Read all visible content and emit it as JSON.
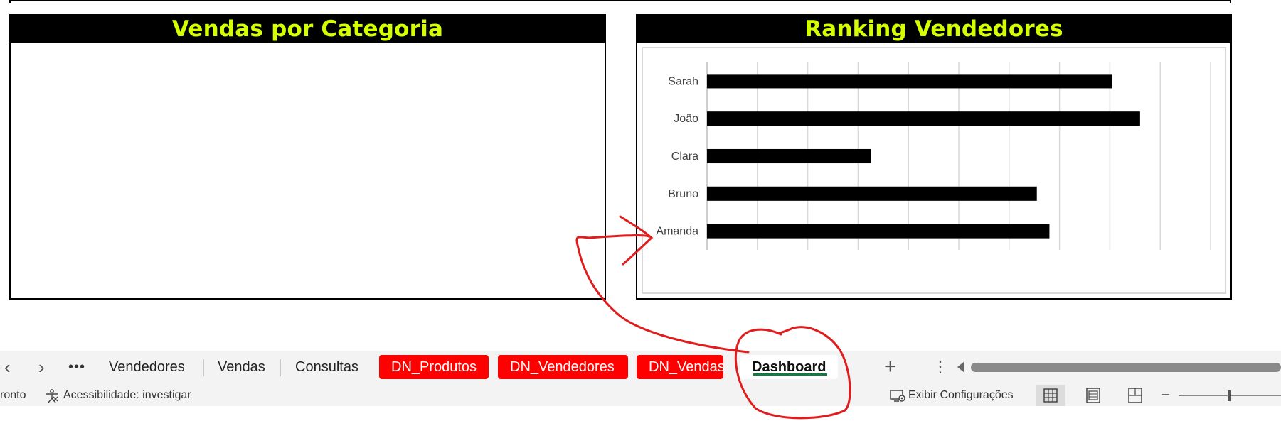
{
  "panels": {
    "left_title": "Vendas por Categoria",
    "right_title": "Ranking Vendedores"
  },
  "chart_data": {
    "type": "bar",
    "orientation": "horizontal",
    "title": "",
    "categories": [
      "Sarah",
      "João",
      "Clara",
      "Bruno",
      "Amanda"
    ],
    "values": [
      8.05,
      8.6,
      3.25,
      6.55,
      6.8
    ],
    "xlim": [
      0,
      10
    ],
    "grid": true,
    "gridline_count": 10,
    "legend": false,
    "bar_color": "#000000"
  },
  "sheet_tabs": [
    {
      "label": "Vendedores",
      "style": "normal"
    },
    {
      "label": "Vendas",
      "style": "normal"
    },
    {
      "label": "Consultas",
      "style": "normal"
    },
    {
      "label": "DN_Produtos",
      "style": "red"
    },
    {
      "label": "DN_Vendedores",
      "style": "red"
    },
    {
      "label": "DN_Vendas",
      "style": "red"
    },
    {
      "label": "Dashboard",
      "style": "active"
    }
  ],
  "tabbar": {
    "prev_icon": "chevron-left-icon",
    "next_icon": "chevron-right-icon",
    "more_label": "•••",
    "add_label": "+",
    "menu_label": "⋮"
  },
  "statusbar": {
    "ready": "ronto",
    "accessibility": "Acessibilidade: investigar",
    "display_settings": "Exibir Configurações"
  },
  "colors": {
    "title_text": "#d4ff00",
    "red_tab": "#ff0000",
    "annotation": "#e01c1c",
    "active_underline": "#107c41"
  }
}
